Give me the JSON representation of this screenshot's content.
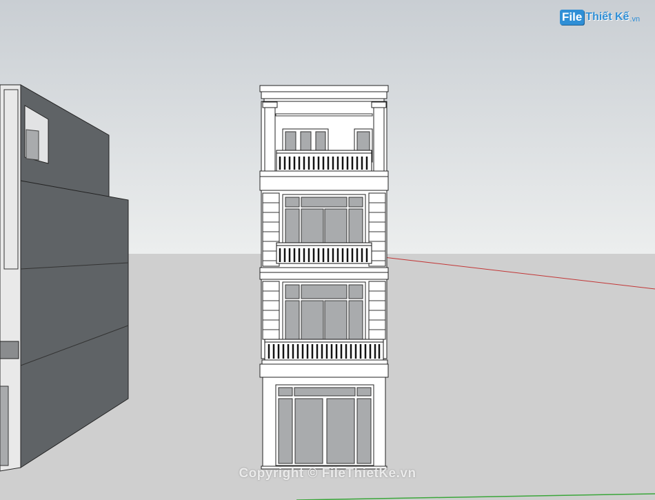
{
  "scene": {
    "type": "sketchup-3d-viewport",
    "description_label": "",
    "colors": {
      "sky_top": "#c9ced3",
      "sky_bottom": "#eceeee",
      "ground": "#cfcfcf",
      "red_axis": "#c23535",
      "green_axis": "#3aa63a",
      "neighbor_dark": "#5f6366",
      "neighbor_side": "#7c8083",
      "facade_white": "#ffffff",
      "glass": "#a9abad"
    }
  },
  "logo": {
    "box_text": "File",
    "name_text": "Thiết Kế",
    "tld_text": ".vn"
  },
  "watermark": {
    "text": "Copyright © FileThietKe.vn"
  }
}
